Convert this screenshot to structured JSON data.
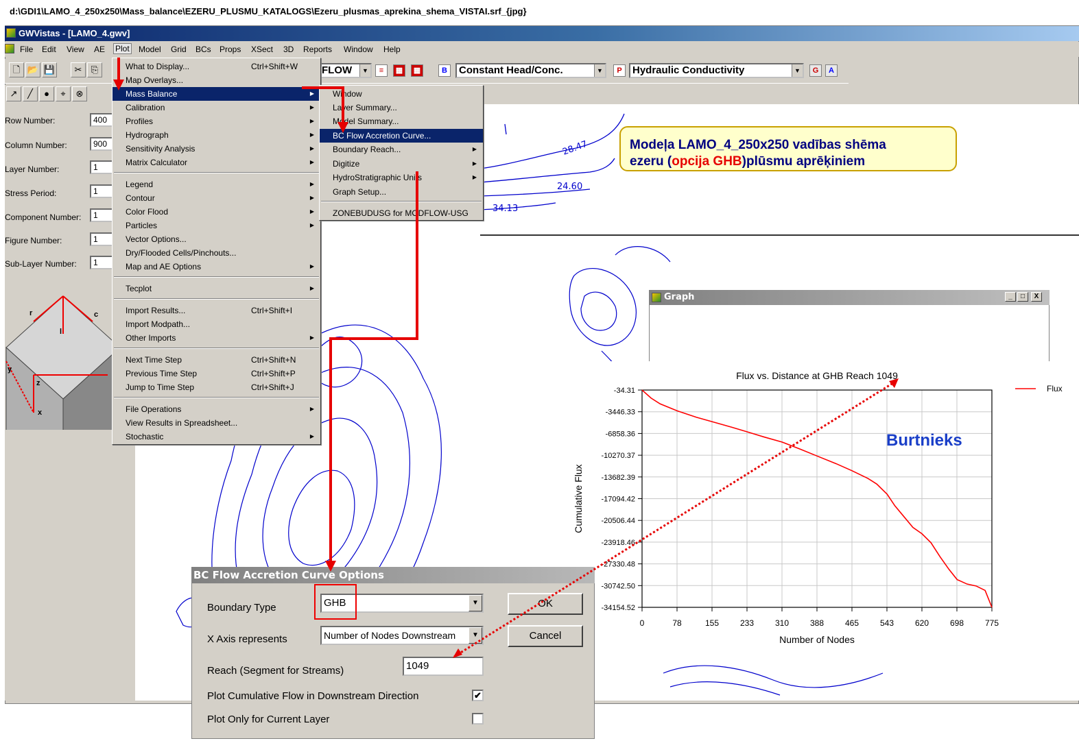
{
  "caption": "d:\\GDI1\\LAMO_4_250x250\\Mass_balance\\EZERU_PLUSMU_KATALOGS\\Ezeru_plusmas_aprekina_shema_VISTAI.srf_{jpg}",
  "window_title": "GWVistas - [LAMO_4.gwv]",
  "menubar": [
    "File",
    "Edit",
    "View",
    "AE",
    "Plot",
    "Model",
    "Grid",
    "BCs",
    "Props",
    "XSect",
    "3D",
    "Reports",
    "Window",
    "Help"
  ],
  "toolbar": {
    "display_combo": "FLOW",
    "bc_combo": "Constant Head/Conc.",
    "prop_combo": "Hydraulic Conductivity",
    "bc_icon": "B",
    "prop_icon": "P",
    "g_icon": "G",
    "a_icon": "A"
  },
  "left_panel": {
    "fields": [
      {
        "label": "Row Number:",
        "value": "400"
      },
      {
        "label": "Column Number:",
        "value": "900"
      },
      {
        "label": "Layer Number:",
        "value": "1"
      },
      {
        "label": "Stress Period:",
        "value": "1"
      },
      {
        "label": "Component Number:",
        "value": "1"
      },
      {
        "label": "Figure Number:",
        "value": "1"
      },
      {
        "label": "Sub-Layer Number:",
        "value": "1"
      }
    ],
    "cube_labels": {
      "r": "r",
      "c": "c",
      "l": "l",
      "z": "z",
      "y": "y",
      "x": "x"
    }
  },
  "plot_menu": [
    {
      "label": "What to Display...",
      "shortcut": "Ctrl+Shift+W"
    },
    {
      "label": "Map Overlays..."
    },
    {
      "label": "Mass Balance",
      "submenu": true,
      "highlight": true
    },
    {
      "label": "Calibration",
      "submenu": true
    },
    {
      "label": "Profiles",
      "submenu": true
    },
    {
      "label": "Hydrograph",
      "submenu": true
    },
    {
      "label": "Sensitivity Analysis",
      "submenu": true
    },
    {
      "label": "Matrix Calculator",
      "submenu": true
    },
    {
      "label": "Legend",
      "submenu": true
    },
    {
      "label": "Contour",
      "submenu": true
    },
    {
      "label": "Color Flood",
      "submenu": true
    },
    {
      "label": "Particles",
      "submenu": true
    },
    {
      "label": "Vector Options..."
    },
    {
      "label": "Dry/Flooded Cells/Pinchouts..."
    },
    {
      "label": "Map and AE Options",
      "submenu": true
    },
    {
      "label": "Tecplot",
      "submenu": true
    },
    {
      "label": "Import Results...",
      "shortcut": "Ctrl+Shift+I"
    },
    {
      "label": "Import Modpath..."
    },
    {
      "label": "Other Imports",
      "submenu": true
    },
    {
      "label": "Next Time Step",
      "shortcut": "Ctrl+Shift+N"
    },
    {
      "label": "Previous Time Step",
      "shortcut": "Ctrl+Shift+P"
    },
    {
      "label": "Jump to Time Step",
      "shortcut": "Ctrl+Shift+J"
    },
    {
      "label": "File Operations",
      "submenu": true
    },
    {
      "label": "View Results in Spreadsheet..."
    },
    {
      "label": "Stochastic",
      "submenu": true
    }
  ],
  "mass_balance_menu": [
    {
      "label": "Window"
    },
    {
      "label": "Layer Summary..."
    },
    {
      "label": "Model Summary..."
    },
    {
      "label": "BC Flow Accretion Curve...",
      "highlight": true
    },
    {
      "label": "Boundary Reach...",
      "submenu": true
    },
    {
      "label": "Digitize",
      "submenu": true
    },
    {
      "label": "HydroStratigraphic Units",
      "submenu": true
    },
    {
      "label": "Graph Setup..."
    },
    {
      "label": "ZONEBUDUSG for MODFLOW-USG"
    }
  ],
  "contour_labels": [
    "28.47",
    "24.60",
    "34.13"
  ],
  "callout": {
    "line1": "Modeļa  LAMO_4_250x250 vadības shēma",
    "line2_pre": "ezeru (",
    "line2_red": "opcija GHB",
    "line2_post": ")plūsmu aprēķiniem"
  },
  "graph_window": {
    "title": "Graph",
    "buttons": [
      "_",
      "□",
      "X"
    ]
  },
  "chart_data": {
    "type": "line",
    "title": "Flux vs. Distance at GHB Reach 1049",
    "xlabel": "Number of Nodes",
    "ylabel": "Cumulative Flux",
    "annotation": "Burtnieks",
    "legend": "top-right",
    "grid": true,
    "xlim": [
      0,
      775
    ],
    "ylim": [
      -34154.52,
      -34.31
    ],
    "x_ticks": [
      "0",
      "78",
      "155",
      "233",
      "310",
      "388",
      "465",
      "543",
      "620",
      "698",
      "775"
    ],
    "y_ticks": [
      "-34.31",
      "-3446.33",
      "-6858.36",
      "-10270.37",
      "-13682.39",
      "-17094.42",
      "-20506.44",
      "-23918.46",
      "-27330.48",
      "-30742.50",
      "-34154.52"
    ],
    "series": [
      {
        "name": "Flux",
        "color": "#ff0000",
        "x": [
          0,
          20,
          40,
          78,
          120,
          155,
          200,
          233,
          270,
          310,
          350,
          388,
          430,
          465,
          500,
          520,
          543,
          560,
          580,
          600,
          620,
          640,
          660,
          680,
          698,
          720,
          740,
          760,
          775
        ],
        "y": [
          -34.31,
          -1300,
          -2200,
          -3300,
          -4300,
          -5000,
          -5900,
          -6600,
          -7400,
          -8200,
          -9300,
          -10400,
          -11600,
          -12700,
          -13900,
          -14800,
          -16400,
          -18200,
          -19900,
          -21600,
          -22600,
          -24000,
          -26200,
          -28200,
          -29800,
          -30500,
          -30800,
          -31500,
          -34154.52
        ]
      }
    ]
  },
  "dialog": {
    "title": "BC Flow Accretion Curve Options",
    "boundary_type_label": "Boundary Type",
    "boundary_type_value": "GHB",
    "x_axis_label": "X Axis represents",
    "x_axis_value": "Number of Nodes Downstream",
    "reach_label": "Reach (Segment for Streams)",
    "reach_value": "1049",
    "cumulative_label": "Plot Cumulative Flow in Downstream Direction",
    "cumulative_checked": true,
    "current_layer_label": "Plot Only for Current Layer",
    "current_layer_checked": false,
    "ok_label": "OK",
    "cancel_label": "Cancel"
  }
}
